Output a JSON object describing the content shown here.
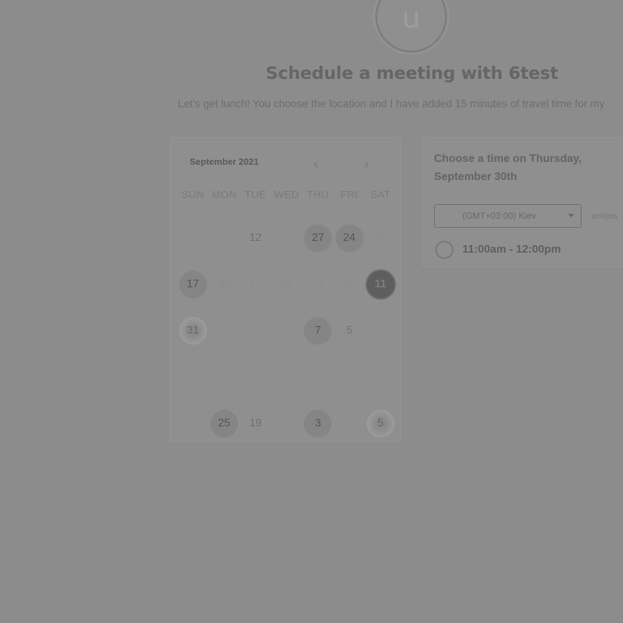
{
  "header": {
    "avatar_initial": "u",
    "title": "Schedule a meeting with 6test",
    "subtitle": "Let's get lunch! You choose the location and I have added 15 minutes of travel time for my"
  },
  "calendar": {
    "month_label": "September 2021",
    "prev_icon": "chevron-left-icon",
    "next_icon": "chevron-right-icon",
    "prev_glyph": "‹",
    "next_glyph": "›",
    "weekdays": [
      "SUN",
      "MON",
      "TUE",
      "WED",
      "THU",
      "FRI",
      "SAT"
    ],
    "weeks": [
      [
        {
          "label": "25",
          "state": "dim"
        },
        {
          "label": "2",
          "state": "dim"
        },
        {
          "label": "12",
          "state": "med"
        },
        {
          "label": "26",
          "state": "dim"
        },
        {
          "label": "27",
          "state": "avail"
        },
        {
          "label": "24",
          "state": "avail"
        },
        {
          "label": "16",
          "state": "dim"
        }
      ],
      [
        {
          "label": "17",
          "state": "avail"
        },
        {
          "label": "30",
          "state": "dim"
        },
        {
          "label": "14",
          "state": "dim"
        },
        {
          "label": "15",
          "state": "dim"
        },
        {
          "label": "17",
          "state": "dim"
        },
        {
          "label": "30",
          "state": "dim"
        },
        {
          "label": "11",
          "state": "selected"
        }
      ],
      [
        {
          "label": "31",
          "state": "fuzzy"
        },
        {
          "label": "23",
          "state": "dim"
        },
        {
          "label": "25",
          "state": "dim"
        },
        {
          "label": "25",
          "state": "dim"
        },
        {
          "label": "7",
          "state": "avail"
        },
        {
          "label": "5",
          "state": "med"
        },
        {
          "label": "10",
          "state": "dim"
        }
      ],
      [
        {
          "label": "16",
          "state": "dim"
        },
        {
          "label": "21",
          "state": "dim"
        },
        {
          "label": "22",
          "state": "dim"
        },
        {
          "label": "24",
          "state": "dim"
        },
        {
          "label": "9",
          "state": "dim"
        },
        {
          "label": "30",
          "state": "dim"
        },
        {
          "label": "13",
          "state": "dim"
        }
      ],
      [
        {
          "label": "13",
          "state": "dim"
        },
        {
          "label": "25",
          "state": "avail"
        },
        {
          "label": "19",
          "state": "med"
        },
        {
          "label": "29",
          "state": "dim"
        },
        {
          "label": "3",
          "state": "avail"
        },
        {
          "label": "24",
          "state": "dim"
        },
        {
          "label": "5",
          "state": "fuzzy"
        }
      ]
    ]
  },
  "time_panel": {
    "heading": "Choose a time on Thursday, September 30th",
    "timezone": "(GMT+03:00) Kiev",
    "timezone_icon": "chevron-down-icon",
    "format_label": "am/pm",
    "slots": [
      {
        "label": "11:00am - 12:00pm"
      }
    ]
  }
}
